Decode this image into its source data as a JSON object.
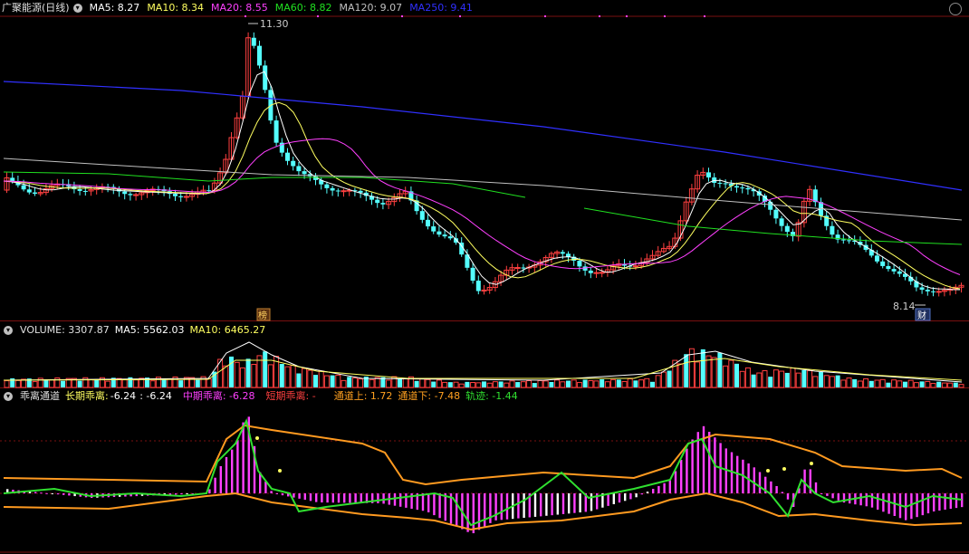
{
  "price_header": {
    "title": "广聚能源(日线)",
    "ma5": "MA5: 8.27",
    "ma10": "MA10: 8.34",
    "ma20": "MA20: 8.55",
    "ma60": "MA60: 8.82",
    "ma120": "MA120: 9.07",
    "ma250": "MA250: 9.41"
  },
  "volume_header": {
    "volume": "VOLUME: 3307.87",
    "ma5": "MA5: 5562.03",
    "ma10": "MA10: 6465.27"
  },
  "indicator_header": {
    "title": "乖离通道",
    "long_label": "长期乖离:",
    "long_value": "-6.24",
    "long_value2": ": -6.24",
    "mid": "中期乖离: -6.28",
    "short": "短期乖离: -",
    "upper": "通道上: 1.72",
    "lower": "通道下: -7.48",
    "trace": "轨迹: -1.44"
  },
  "annotations": {
    "high_price": "11.30",
    "low_price": "8.14",
    "marker_bang": "榜",
    "marker_cai": "财"
  },
  "colors": {
    "up": "#ff4040",
    "down": "#54ffff",
    "ma5": "#ffffff",
    "ma10": "#ffff60",
    "ma20": "#ff40ff",
    "ma60": "#20e020",
    "ma120": "#c0c0c0",
    "ma250": "#3030ff",
    "channel": "#ff9a20",
    "trace": "#30e030",
    "bar_mid": "#ff40ff"
  }
}
